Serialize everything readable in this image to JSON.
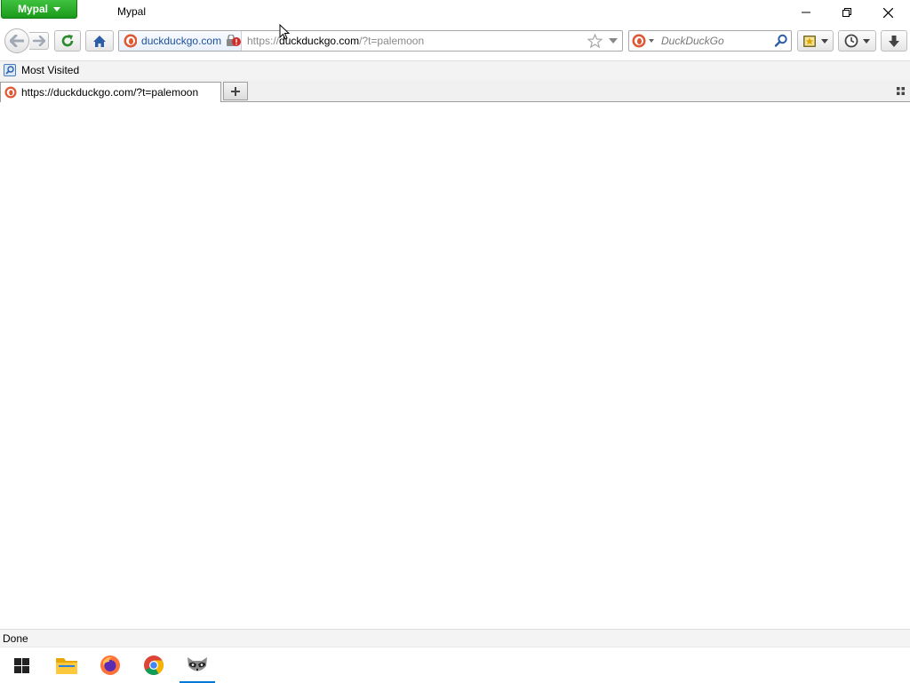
{
  "titlebar": {
    "app_menu_label": "Mypal",
    "window_title": "Mypal"
  },
  "navbar": {
    "identity_label": "duckduckgo.com",
    "url_prefix": "https://",
    "url_host": "duckduckgo.com",
    "url_suffix": "/?t=palemoon",
    "search_placeholder": "DuckDuckGo"
  },
  "bookmarks": {
    "items": [
      {
        "label": "Most Visited",
        "icon": "bookmark-folder-icon"
      }
    ]
  },
  "tabs": [
    {
      "label": "https://duckduckgo.com/?t=palemoon",
      "icon": "duckduckgo-favicon"
    }
  ],
  "statusbar": {
    "text": "Done"
  },
  "taskbar": {
    "items": [
      {
        "name": "start-button",
        "icon": "windows-logo-icon"
      },
      {
        "name": "file-explorer",
        "icon": "folder-icon"
      },
      {
        "name": "firefox",
        "icon": "firefox-icon"
      },
      {
        "name": "chrome",
        "icon": "chrome-icon"
      },
      {
        "name": "mypal",
        "icon": "raccoon-icon",
        "active": true
      }
    ]
  },
  "colors": {
    "accent": "#0078d7",
    "app_button": "#2aaa2a",
    "link_blue": "#1b4f9b"
  }
}
